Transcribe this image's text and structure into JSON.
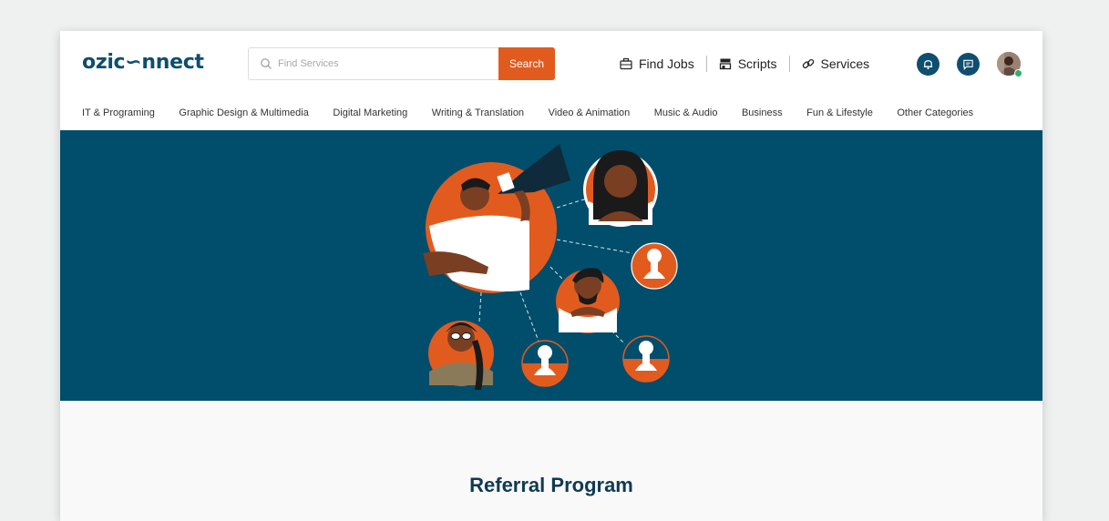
{
  "header": {
    "logo": "ozic∽nnect",
    "search": {
      "placeholder": "Find Services",
      "button": "Search"
    },
    "links": [
      {
        "label": "Find Jobs",
        "icon": "briefcase-icon"
      },
      {
        "label": "Scripts",
        "icon": "store-icon"
      },
      {
        "label": "Services",
        "icon": "link-icon"
      }
    ],
    "actions": {
      "notification_icon": "bell-icon",
      "message_icon": "chat-icon",
      "avatar_icon": "user-avatar"
    }
  },
  "categories": [
    "IT & Programing",
    "Graphic Design & Multimedia",
    "Digital Marketing",
    "Writing & Translation",
    "Video & Animation",
    "Music & Audio",
    "Business",
    "Fun & Lifestyle",
    "Other Categories"
  ],
  "main": {
    "title": "Referral Program"
  },
  "colors": {
    "brand": "#0e4e6e",
    "accent": "#e25b1e",
    "hero_bg": "#014d6c",
    "online": "#28b463"
  }
}
